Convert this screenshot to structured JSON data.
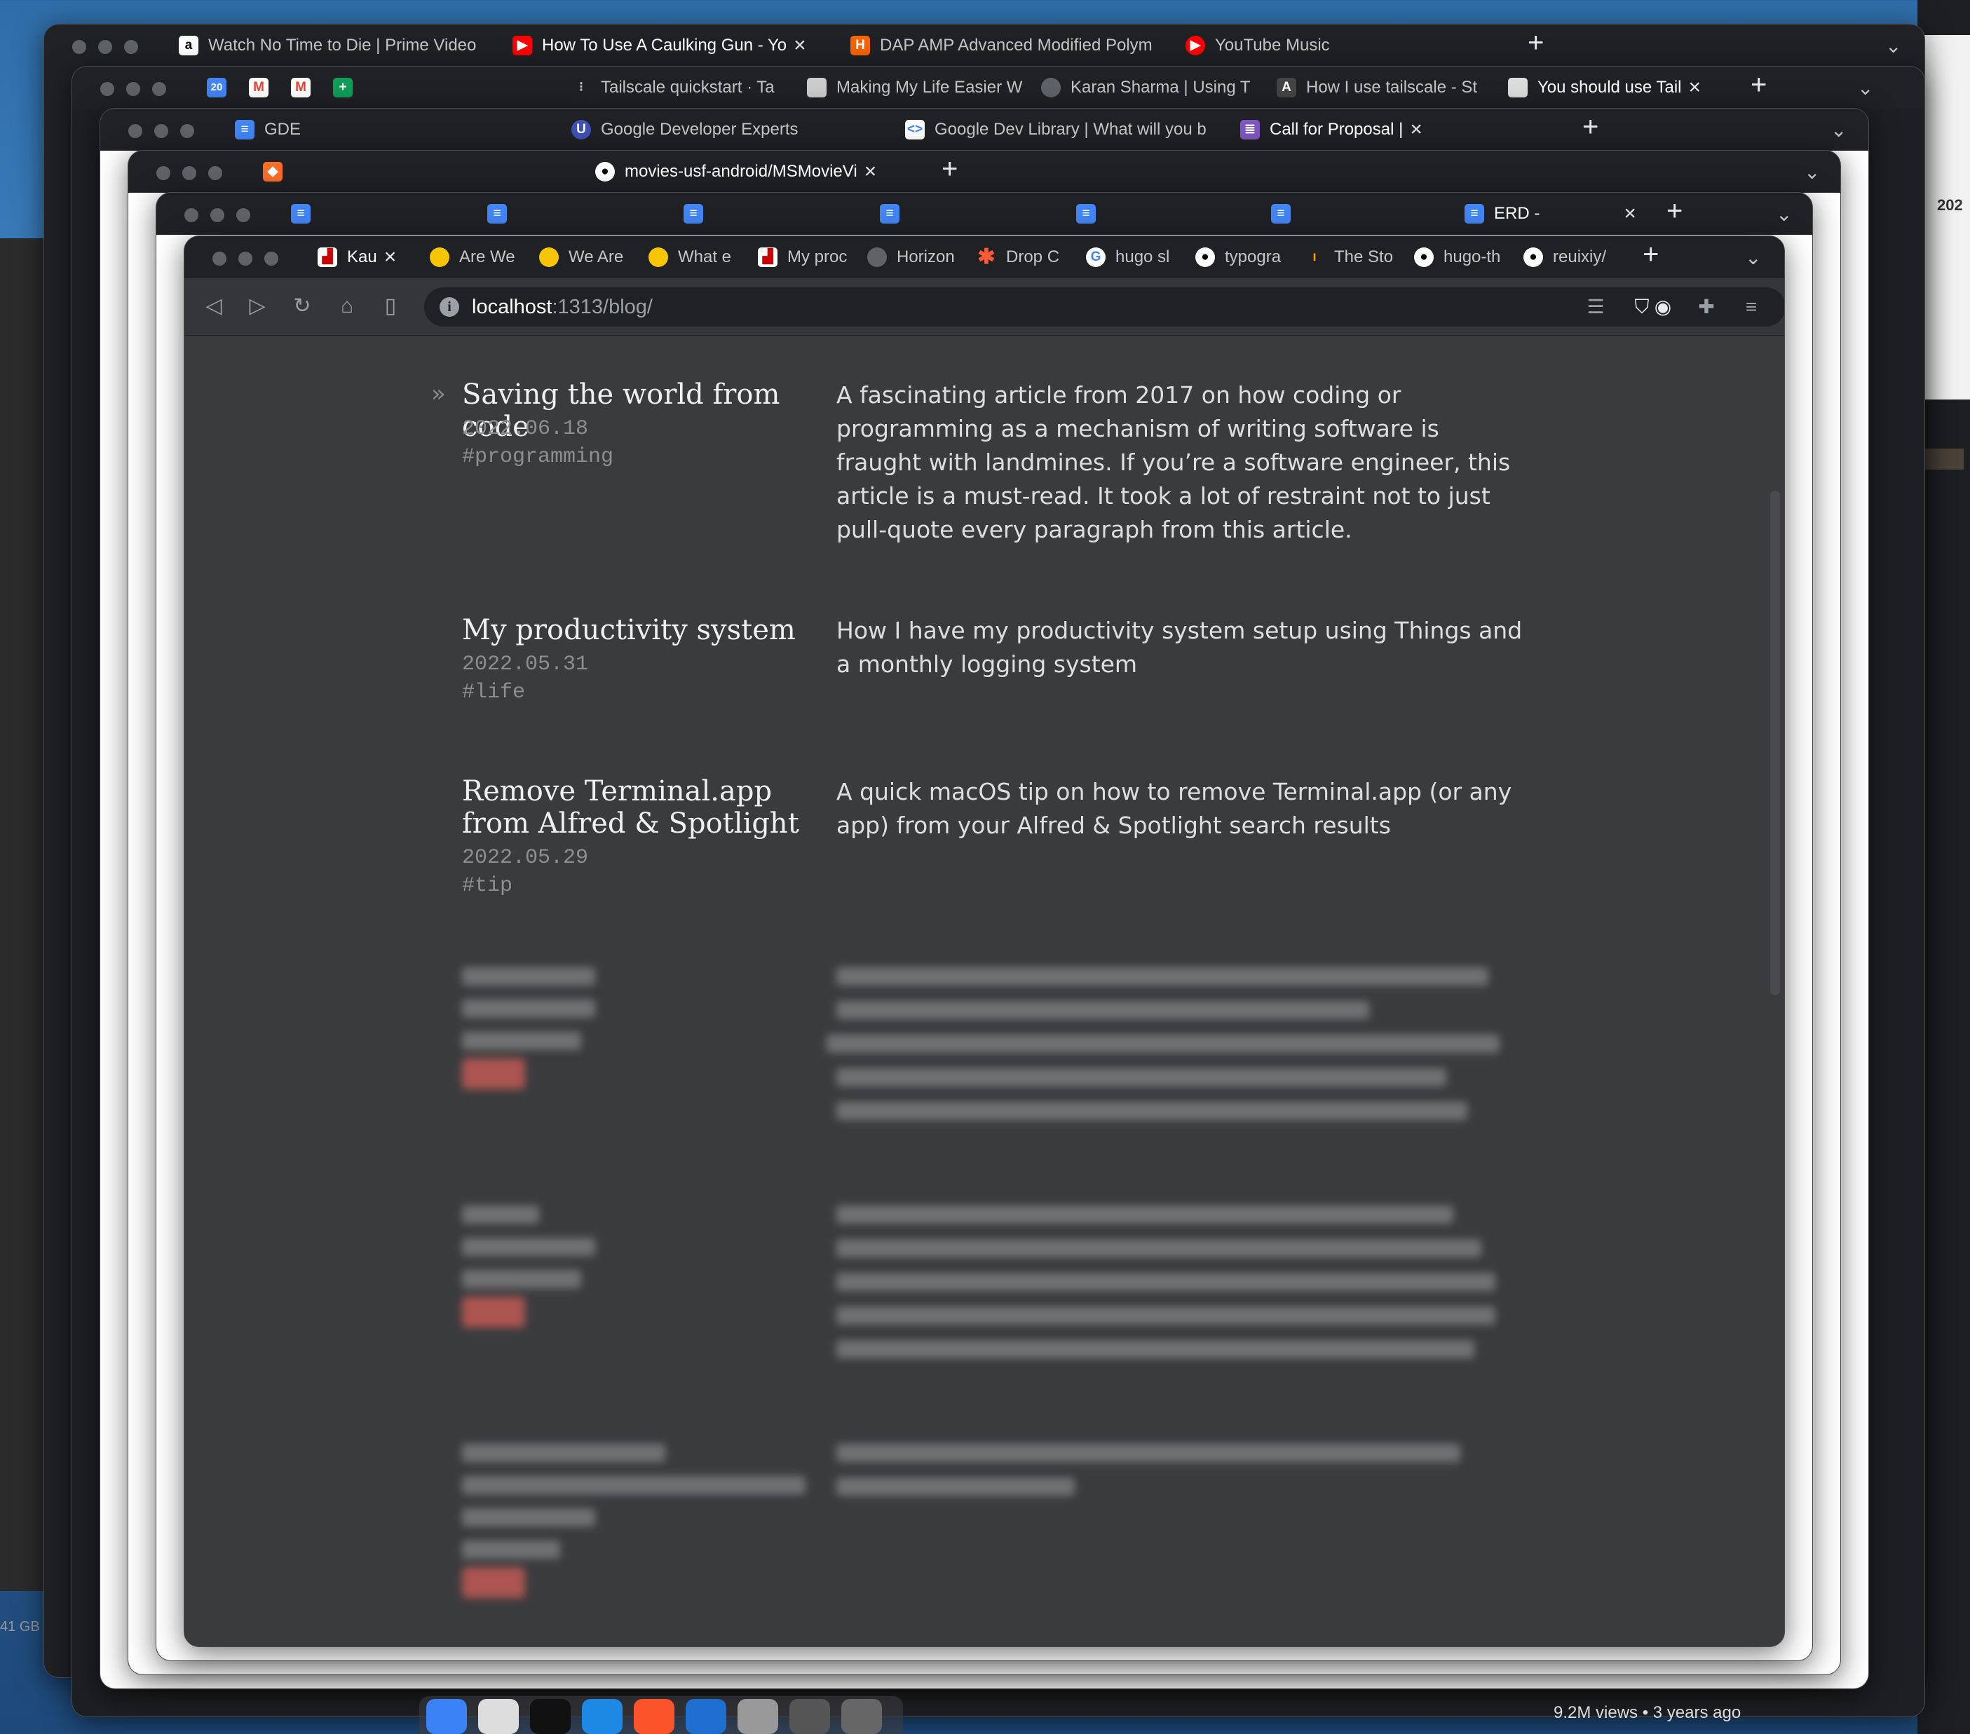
{
  "background_windows": [
    {
      "tabs": [
        "Watch No Time to Die | Prime Video",
        "How To Use A Caulking Gun - Yo",
        "DAP AMP Advanced Modified Polym",
        "YouTube Music"
      ]
    },
    {
      "tabs": [
        "Tailscale quickstart · Ta",
        "Making My Life Easier W",
        "Karan Sharma | Using T",
        "How I use tailscale - St",
        "You should use Tail"
      ]
    },
    {
      "tabs": [
        "GDE",
        "Google Developer Experts",
        "Google Dev Library | What will you b",
        "Call for Proposal | "
      ]
    },
    {
      "tabs": [
        "movies-usf-android/MSMovieVi"
      ]
    },
    {
      "tabs": [
        "ERD -"
      ]
    }
  ],
  "front_window": {
    "tabs": [
      "Kau",
      "Are We",
      "We Are",
      "What e",
      "My proc",
      "Horizon",
      "Drop C",
      "hugo sl",
      "typogra",
      "The Sto",
      "hugo-th",
      "reuixiy/"
    ],
    "url_host": "localhost",
    "url_port_path": ":1313/blog/"
  },
  "posts": [
    {
      "title": "Saving the world from code",
      "date": "2022.06.18",
      "tag": "#programming",
      "desc": "A fascinating article from 2017 on how coding or programming as a mechanism of writing software is fraught with landmines. If you’re a software engineer, this article is a must-read. It took a lot of restraint not to just pull-quote every paragraph from this article."
    },
    {
      "title": "My productivity system",
      "date": "2022.05.31",
      "tag": "#life",
      "desc": "How I have my productivity system setup using Things and a monthly logging system"
    },
    {
      "title": "Remove Terminal.app from Alfred & Spotlight",
      "date": "2022.05.29",
      "tag": "#tip",
      "desc": "A quick macOS tip on how to remove Terminal.app (or any app) from your Alfred & Spotlight search results"
    }
  ],
  "desktop": {
    "youtube_meta": "9.2M views • 3 years ago",
    "right_year": "202",
    "left_status": "41 GB"
  },
  "icons": [
    "back-icon",
    "forward-icon",
    "reload-icon",
    "home-icon",
    "bookmark-icon",
    "info-icon",
    "reader-mode-icon",
    "brave-shield-icon",
    "extension-icon",
    "puzzle-icon",
    "menu-icon"
  ]
}
